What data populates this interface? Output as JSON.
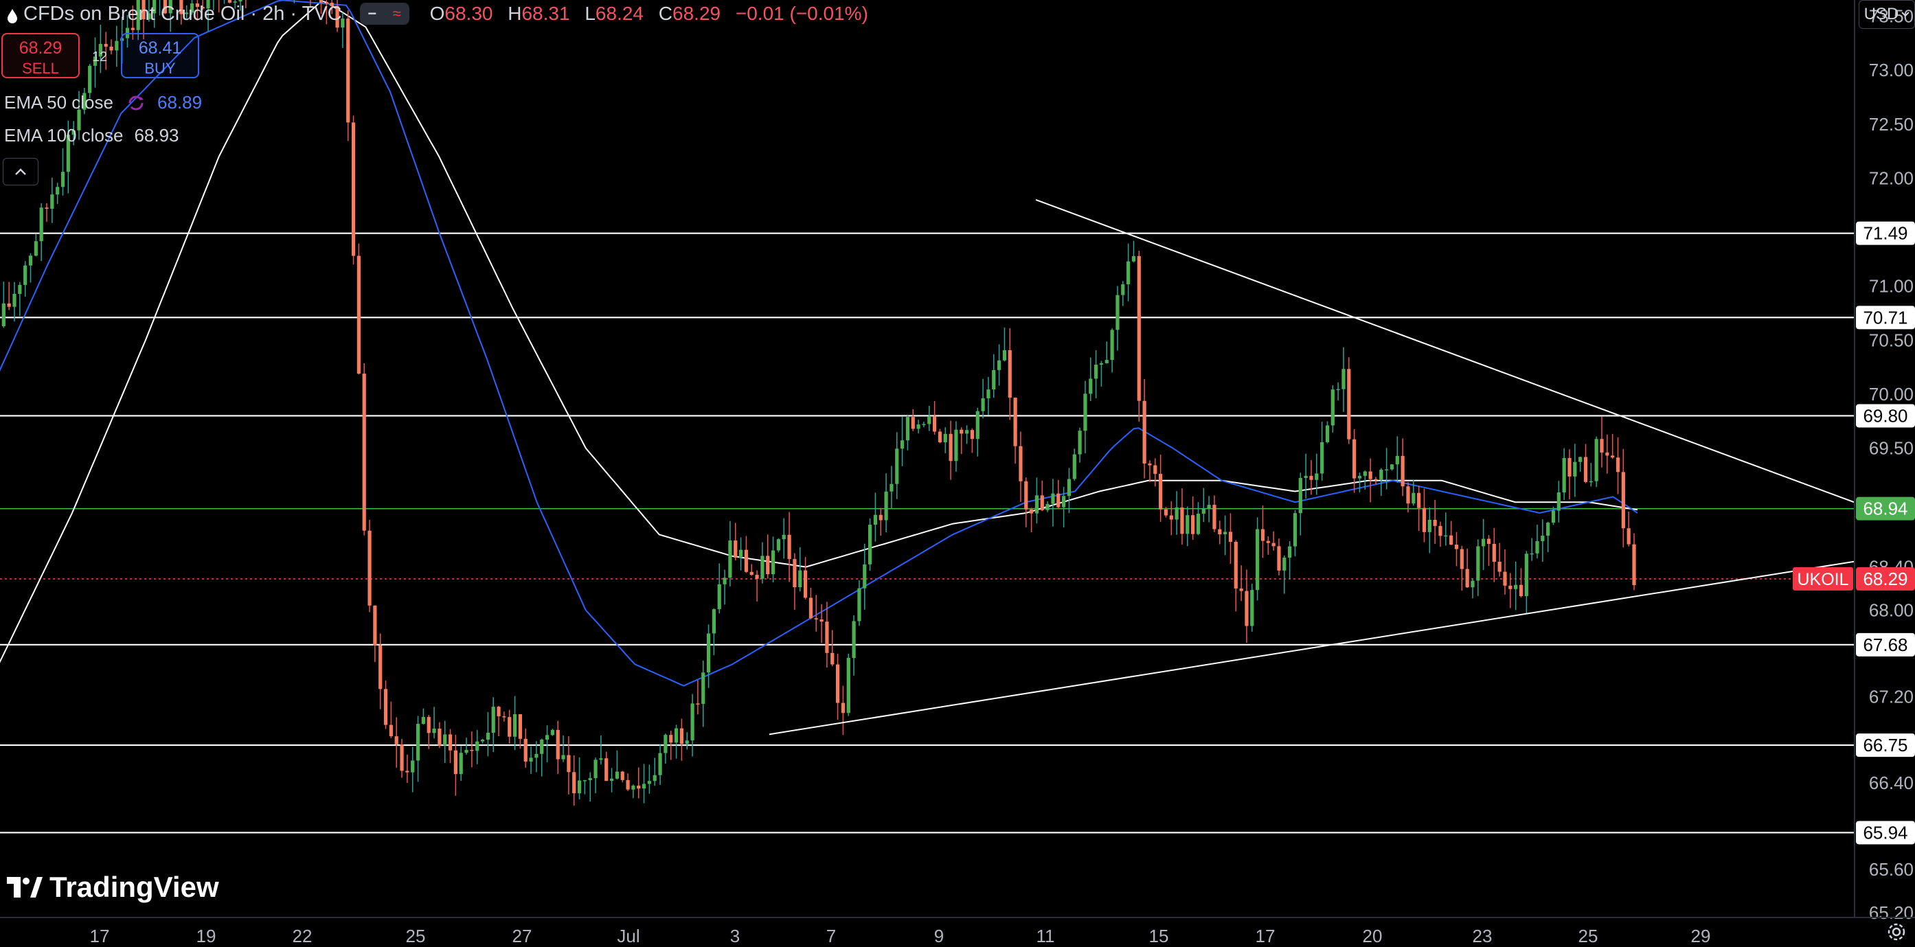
{
  "header": {
    "title": "CFDs on Brent Crude Oil · 2h · TVC",
    "ohlc": [
      {
        "k": "O",
        "v": "68.30"
      },
      {
        "k": "H",
        "v": "68.31"
      },
      {
        "k": "L",
        "v": "68.24"
      },
      {
        "k": "C",
        "v": "68.29"
      },
      {
        "k": "",
        "v": "−0.01 (−0.01%)"
      }
    ],
    "minus_glyph": "−",
    "wave_glyph": "≈"
  },
  "trade": {
    "sell_price": "68.29",
    "sell_label": "SELL",
    "buy_price": "68.41",
    "buy_label": "BUY",
    "qty": "12"
  },
  "indicators": {
    "ema50_label": "EMA 50 close",
    "ema50_value": "68.89",
    "ema100_label": "EMA 100 close",
    "ema100_value": "68.93"
  },
  "currency": "USD",
  "brand": "TradingView",
  "colors": {
    "background": "#000000",
    "up": "#26a69a",
    "up_body": "#4caf50",
    "down": "#ef5350",
    "down_body": "#f77c5d",
    "ema50": "#2962ff",
    "ema100": "#ffffff",
    "level": "#ffffff",
    "green_level": "#4caf50",
    "last_price": "#f23645"
  },
  "chart_data": {
    "type": "candlestick",
    "y_axis": {
      "range": [
        64.9,
        73.65
      ],
      "ticks": [
        "73.50",
        "73.00",
        "72.50",
        "72.00",
        "71.00",
        "70.50",
        "70.00",
        "69.50",
        "68.40",
        "68.00",
        "67.20",
        "66.40",
        "65.60",
        "65.20"
      ]
    },
    "x_axis": {
      "ticks": [
        "17",
        "19",
        "22",
        "25",
        "27",
        "Jul",
        "3",
        "7",
        "9",
        "11",
        "15",
        "17",
        "20",
        "23",
        "25",
        "29"
      ]
    },
    "horizontal_levels": [
      {
        "price": 71.49,
        "label": "71.49"
      },
      {
        "price": 70.71,
        "label": "70.71"
      },
      {
        "price": 69.8,
        "label": "69.80"
      },
      {
        "price": 67.68,
        "label": "67.68"
      },
      {
        "price": 66.75,
        "label": "66.75"
      },
      {
        "price": 65.94,
        "label": "65.94"
      }
    ],
    "green_level": {
      "price": 68.94,
      "label": "68.94"
    },
    "last_price": {
      "price": 68.29,
      "label": "68.29",
      "symbol": "UKOIL"
    },
    "trendlines": [
      {
        "from": [
          "Jul 12",
          71.8
        ],
        "to": [
          "Jul 29",
          69.0
        ]
      },
      {
        "from": [
          "Jul 4",
          66.85
        ],
        "to": [
          "Jul 29",
          68.45
        ]
      }
    ],
    "series": [
      {
        "name": "EMA 50 close",
        "last_value": 68.89
      },
      {
        "name": "EMA 100 close",
        "last_value": 68.93
      }
    ],
    "price_anchors": [
      [
        0,
        70.6
      ],
      [
        38,
        71.7
      ],
      [
        75,
        73.0
      ],
      [
        115,
        73.6
      ],
      [
        180,
        73.75
      ],
      [
        245,
        73.95
      ],
      [
        268,
        73.7
      ],
      [
        282,
        73.4
      ],
      [
        290,
        71.4
      ],
      [
        298,
        69.0
      ],
      [
        306,
        67.6
      ],
      [
        318,
        67.0
      ],
      [
        330,
        66.5
      ],
      [
        350,
        67.0
      ],
      [
        372,
        66.6
      ],
      [
        392,
        66.8
      ],
      [
        412,
        67.1
      ],
      [
        432,
        66.7
      ],
      [
        452,
        66.9
      ],
      [
        470,
        66.2
      ],
      [
        488,
        66.6
      ],
      [
        508,
        66.5
      ],
      [
        528,
        66.4
      ],
      [
        548,
        66.8
      ],
      [
        568,
        67.0
      ],
      [
        582,
        67.8
      ],
      [
        598,
        68.6
      ],
      [
        620,
        68.3
      ],
      [
        640,
        68.6
      ],
      [
        660,
        68.1
      ],
      [
        675,
        67.8
      ],
      [
        690,
        67.0
      ],
      [
        705,
        68.4
      ],
      [
        720,
        68.9
      ],
      [
        740,
        69.6
      ],
      [
        760,
        69.9
      ],
      [
        780,
        69.5
      ],
      [
        800,
        69.8
      ],
      [
        822,
        70.3
      ],
      [
        838,
        69.1
      ],
      [
        856,
        68.9
      ],
      [
        875,
        69.2
      ],
      [
        890,
        70.2
      ],
      [
        908,
        70.5
      ],
      [
        922,
        71.3
      ],
      [
        928,
        71.2
      ],
      [
        934,
        69.4
      ],
      [
        950,
        69.0
      ],
      [
        972,
        68.8
      ],
      [
        992,
        68.9
      ],
      [
        1010,
        68.4
      ],
      [
        1020,
        67.9
      ],
      [
        1030,
        68.8
      ],
      [
        1050,
        68.4
      ],
      [
        1065,
        69.2
      ],
      [
        1082,
        69.5
      ],
      [
        1098,
        70.3
      ],
      [
        1106,
        69.4
      ],
      [
        1120,
        69.1
      ],
      [
        1140,
        69.4
      ],
      [
        1160,
        68.9
      ],
      [
        1180,
        68.6
      ],
      [
        1200,
        68.3
      ],
      [
        1220,
        68.6
      ],
      [
        1238,
        68.0
      ],
      [
        1250,
        68.4
      ],
      [
        1268,
        68.7
      ],
      [
        1282,
        69.4
      ],
      [
        1300,
        69.3
      ],
      [
        1312,
        69.6
      ],
      [
        1324,
        69.3
      ],
      [
        1330,
        68.6
      ],
      [
        1338,
        68.3
      ]
    ],
    "ema50_anchors": [
      [
        0,
        70.2
      ],
      [
        40,
        71.2
      ],
      [
        100,
        72.6
      ],
      [
        160,
        73.3
      ],
      [
        230,
        73.65
      ],
      [
        285,
        73.6
      ],
      [
        320,
        72.8
      ],
      [
        360,
        71.5
      ],
      [
        400,
        70.3
      ],
      [
        440,
        69.0
      ],
      [
        480,
        68.0
      ],
      [
        520,
        67.5
      ],
      [
        560,
        67.3
      ],
      [
        600,
        67.5
      ],
      [
        660,
        67.9
      ],
      [
        720,
        68.3
      ],
      [
        780,
        68.7
      ],
      [
        840,
        69.0
      ],
      [
        880,
        69.1
      ],
      [
        910,
        69.5
      ],
      [
        930,
        69.7
      ],
      [
        960,
        69.5
      ],
      [
        1000,
        69.2
      ],
      [
        1060,
        69.0
      ],
      [
        1100,
        69.1
      ],
      [
        1140,
        69.2
      ],
      [
        1180,
        69.1
      ],
      [
        1220,
        69.0
      ],
      [
        1260,
        68.9
      ],
      [
        1300,
        69.0
      ],
      [
        1320,
        69.05
      ],
      [
        1340,
        68.9
      ]
    ],
    "ema100_anchors": [
      [
        0,
        67.5
      ],
      [
        60,
        68.9
      ],
      [
        120,
        70.5
      ],
      [
        180,
        72.2
      ],
      [
        230,
        73.3
      ],
      [
        265,
        73.65
      ],
      [
        300,
        73.4
      ],
      [
        360,
        72.2
      ],
      [
        420,
        70.8
      ],
      [
        480,
        69.5
      ],
      [
        540,
        68.7
      ],
      [
        600,
        68.5
      ],
      [
        660,
        68.4
      ],
      [
        720,
        68.6
      ],
      [
        780,
        68.8
      ],
      [
        840,
        68.9
      ],
      [
        900,
        69.1
      ],
      [
        940,
        69.2
      ],
      [
        1000,
        69.2
      ],
      [
        1060,
        69.1
      ],
      [
        1120,
        69.2
      ],
      [
        1180,
        69.2
      ],
      [
        1240,
        69.0
      ],
      [
        1300,
        69.0
      ],
      [
        1340,
        68.93
      ]
    ]
  }
}
